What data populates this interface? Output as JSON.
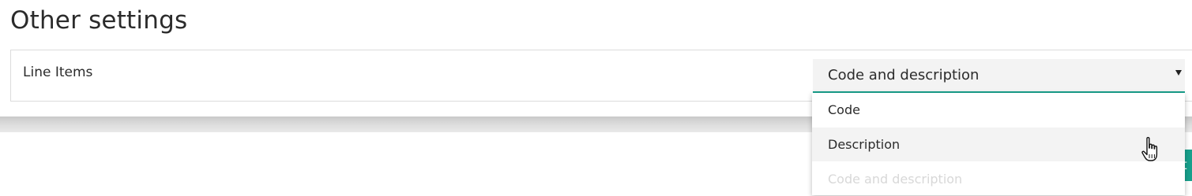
{
  "section": {
    "title": "Other settings"
  },
  "line_items": {
    "label": "Line Items",
    "selected_value": "Code and description",
    "options": [
      {
        "label": "Code",
        "state": "normal"
      },
      {
        "label": "Description",
        "state": "hovered"
      },
      {
        "label": "Code and description",
        "state": "disabled"
      }
    ]
  },
  "action_button": {
    "label": "t"
  },
  "colors": {
    "accent": "#17a08c",
    "text": "#2b2b2b",
    "select_background": "#f3f3f3",
    "disabled_text": "#d8d8d8"
  },
  "icons": {
    "dropdown_arrow": "dropdown-arrow-icon",
    "cursor": "hand-cursor-icon"
  }
}
